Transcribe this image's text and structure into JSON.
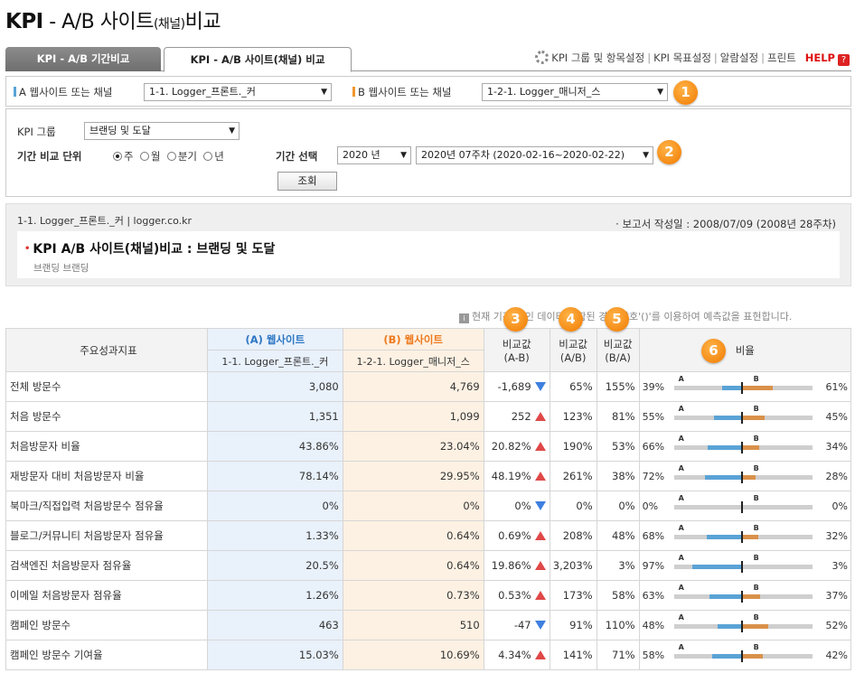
{
  "page": {
    "title_main": "KPI",
    "title_mid": " - A/B 사이트",
    "title_paren": "(채널)",
    "title_end": "비교"
  },
  "tabs": [
    {
      "label": "KPI - A/B 기간비교"
    },
    {
      "label": "KPI - A/B 사이트(채널) 비교"
    }
  ],
  "toplinks": {
    "kpi_group": "KPI 그룹 및 항목설정",
    "kpi_target": "KPI 목표설정",
    "alarm": "알람설정",
    "print": "프린트",
    "help": "HELP",
    "help_icon": "?"
  },
  "selectors": {
    "a_label": "A 웹사이트 또는 채널",
    "a_value": "1-1. Logger_프론트._커",
    "b_label": "B 웹사이트 또는 채널",
    "b_value": "1-2-1. Logger_매니저_스",
    "badge1": "1",
    "badge2": "2",
    "badge3": "3",
    "badge4": "4",
    "badge5": "5",
    "badge6": "6"
  },
  "filters": {
    "group_label": "KPI 그룹",
    "group_value": "브랜딩 및 도달",
    "unit_label": "기간 비교 단위",
    "unit_options": [
      "주",
      "월",
      "분기",
      "년"
    ],
    "unit_selected": "주",
    "period_label": "기간 선택",
    "year_value": "2020 년",
    "week_value": "2020년 07주차 (2020-02-16~2020-02-22)",
    "search_button": "조회"
  },
  "report": {
    "subtitle": "1-1. Logger_프론트._커  |  logger.co.kr",
    "date": "· 보고서 작성일 : 2008/07/09 (2008년 28주차)",
    "title": "KPI A/B 사이트(채널)비교 : 브랜딩 및 도달",
    "desc": "브랜딩 브랜딩"
  },
  "note": {
    "icon": "i",
    "text": "현재 기간(1 인 데이터 포함된 경우 괄호'()'를 이용하여 예측값을 표현합니다."
  },
  "table": {
    "h_kpi": "주요성과지표",
    "h_a": "(A) 웹사이트",
    "h_a_sub": "1-1. Logger_프론트._커",
    "h_b": "(B) 웹사이트",
    "h_b_sub": "1-2-1. Logger_매니저_스",
    "h_diff": "비교값",
    "h_diff_sub": "(A-B)",
    "h_ab": "비교값",
    "h_ab_sub": "(A/B)",
    "h_ba": "비교값",
    "h_ba_sub": "(B/A)",
    "h_ratio": "비율",
    "marker_a": "A",
    "marker_b": "B",
    "rows": [
      {
        "name": "전체 방문수",
        "a": "3,080",
        "b": "4,769",
        "diff": "-1,689",
        "dir": "down",
        "ab": "65%",
        "ba": "155%",
        "pa": "39%",
        "pb": "61%",
        "ra": 0.39
      },
      {
        "name": "처음 방문수",
        "a": "1,351",
        "b": "1,099",
        "diff": "252",
        "dir": "up",
        "ab": "123%",
        "ba": "81%",
        "pa": "55%",
        "pb": "45%",
        "ra": 0.55
      },
      {
        "name": "처음방문자 비율",
        "a": "43.86%",
        "b": "23.04%",
        "diff": "20.82%",
        "dir": "up",
        "ab": "190%",
        "ba": "53%",
        "pa": "66%",
        "pb": "34%",
        "ra": 0.66
      },
      {
        "name": "재방문자 대비 처음방문자 비율",
        "a": "78.14%",
        "b": "29.95%",
        "diff": "48.19%",
        "dir": "up",
        "ab": "261%",
        "ba": "38%",
        "pa": "72%",
        "pb": "28%",
        "ra": 0.72
      },
      {
        "name": "북마크/직접입력 처음방문수 점유율",
        "a": "0%",
        "b": "0%",
        "diff": "0%",
        "dir": "down",
        "ab": "0%",
        "ba": "0%",
        "pa": "0%",
        "pb": "0%",
        "ra": 0
      },
      {
        "name": "블로그/커뮤니티 처음방문자 점유율",
        "a": "1.33%",
        "b": "0.64%",
        "diff": "0.69%",
        "dir": "up",
        "ab": "208%",
        "ba": "48%",
        "pa": "68%",
        "pb": "32%",
        "ra": 0.68
      },
      {
        "name": "검색엔진 처음방문자 점유율",
        "a": "20.5%",
        "b": "0.64%",
        "diff": "19.86%",
        "dir": "up",
        "ab": "3,203%",
        "ba": "3%",
        "pa": "97%",
        "pb": "3%",
        "ra": 0.97
      },
      {
        "name": "이메일 처음방문자 점유율",
        "a": "1.26%",
        "b": "0.73%",
        "diff": "0.53%",
        "dir": "up",
        "ab": "173%",
        "ba": "58%",
        "pa": "63%",
        "pb": "37%",
        "ra": 0.63
      },
      {
        "name": "캠페인 방문수",
        "a": "463",
        "b": "510",
        "diff": "-47",
        "dir": "down",
        "ab": "91%",
        "ba": "110%",
        "pa": "48%",
        "pb": "52%",
        "ra": 0.48
      },
      {
        "name": "캠페인 방문수 기여율",
        "a": "15.03%",
        "b": "10.69%",
        "diff": "4.34%",
        "dir": "up",
        "ab": "141%",
        "ba": "71%",
        "pa": "58%",
        "pb": "42%",
        "ra": 0.58
      }
    ]
  },
  "colors": {
    "a_blue": "#5aa3d6",
    "b_orange": "#d9914a",
    "up_red": "#e04848",
    "down_blue": "#3e7fe0",
    "badge_orange": "#f07a00"
  }
}
